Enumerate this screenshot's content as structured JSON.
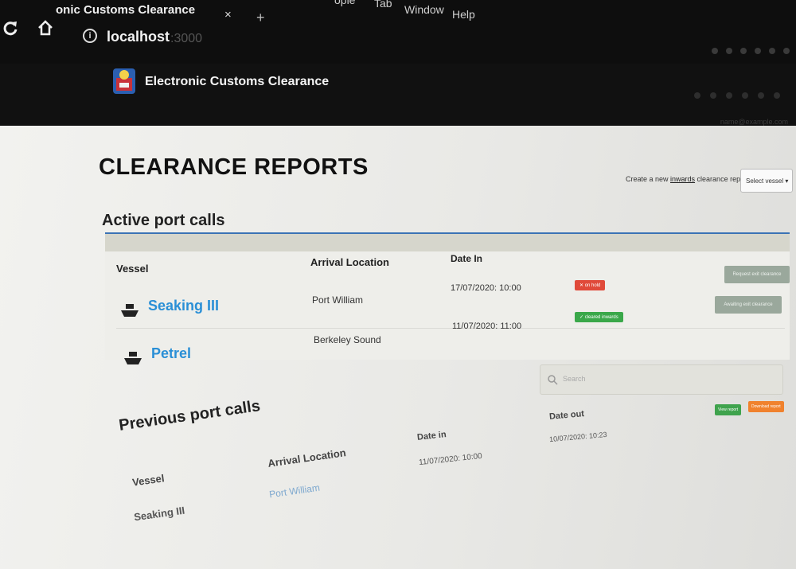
{
  "browser": {
    "tab_title": "onic Customs Clearance",
    "tab_close": "×",
    "tab_new": "+",
    "menu": [
      "ople",
      "Tab",
      "Window",
      "Help"
    ],
    "info_glyph": "i",
    "url_host": "localhost",
    "url_port": ":3000"
  },
  "app": {
    "title": "Electronic Customs Clearance",
    "user_text": "name@example.com"
  },
  "page": {
    "title": "CLEARANCE REPORTS",
    "create_prefix": "Create a new ",
    "create_link": "inwards",
    "create_suffix": " clearance report",
    "select_vessel": "Select vessel ▾"
  },
  "active": {
    "title": "Active port calls",
    "headers": {
      "vessel": "Vessel",
      "arrival": "Arrival Location",
      "date_in": "Date In"
    },
    "rows": [
      {
        "vessel": "Seaking III",
        "arrival": "Port William",
        "date_in": "17/07/2020: 10:00",
        "status": "✕ on hold",
        "action": "Request exit clearance"
      },
      {
        "vessel": "Petrel",
        "arrival": "Berkeley Sound",
        "date_in": "11/07/2020: 11:00",
        "status": "✓ cleared inwards",
        "action": "Awaiting exit clearance"
      }
    ]
  },
  "search": {
    "placeholder": "Search"
  },
  "previous": {
    "title": "Previous port calls",
    "headers": {
      "vessel": "Vessel",
      "arrival": "Arrival Location",
      "date_in": "Date in",
      "date_out": "Date out"
    },
    "rows": [
      {
        "vessel": "Seaking III",
        "arrival": "Port William",
        "date_in": "11/07/2020: 10:00",
        "date_out": "10/07/2020: 10:23",
        "btn_view": "View report",
        "btn_download": "Download report"
      }
    ]
  },
  "colors": {
    "link": "#2a8fd6",
    "accent_line": "#3b73b5",
    "danger": "#e04a3a",
    "success": "#3aa84a",
    "warning": "#f0822e"
  }
}
